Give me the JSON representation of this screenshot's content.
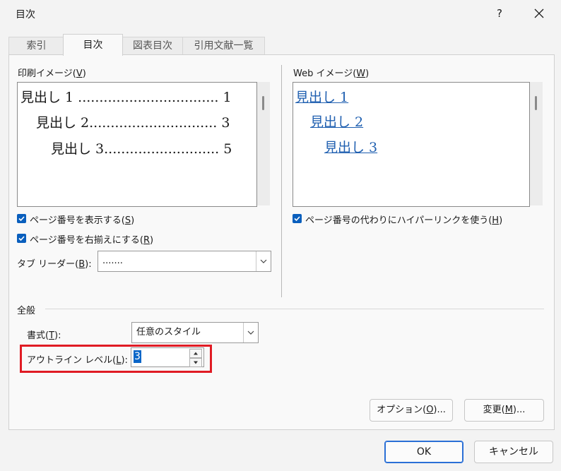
{
  "window": {
    "title": "目次",
    "help_label": "?",
    "close_icon": "close-icon"
  },
  "tabs": [
    {
      "label": "索引",
      "active": false
    },
    {
      "label": "目次",
      "active": true
    },
    {
      "label": "図表目次",
      "active": false
    },
    {
      "label": "引用文献一覧",
      "active": false
    }
  ],
  "print_preview": {
    "label_prefix": "印刷イメージ(",
    "label_key": "V",
    "label_suffix": ")",
    "entries": [
      {
        "text": "見出し 1 ................................. 1"
      },
      {
        "text": "見出し 2.............................. 3"
      },
      {
        "text": "見出し 3........................... 5"
      }
    ]
  },
  "web_preview": {
    "label_prefix": "Web イメージ(",
    "label_key": "W",
    "label_suffix": ")",
    "entries": [
      {
        "text": "見出し 1"
      },
      {
        "text": "見出し 2"
      },
      {
        "text": "見出し 3"
      }
    ]
  },
  "options": {
    "show_page_numbers": {
      "prefix": "ページ番号を表示する(",
      "key": "S",
      "suffix": ")",
      "checked": true
    },
    "right_align": {
      "prefix": "ページ番号を右揃えにする(",
      "key": "R",
      "suffix": ")",
      "checked": true
    },
    "tab_leader": {
      "prefix": "タブ リーダー(",
      "key": "B",
      "suffix": "):",
      "value": "......."
    },
    "use_hyperlinks": {
      "prefix": "ページ番号の代わりにハイパーリンクを使う(",
      "key": "H",
      "suffix": ")",
      "checked": true
    }
  },
  "general": {
    "heading": "全般",
    "format": {
      "prefix": "書式(",
      "key": "T",
      "suffix": "):",
      "value": "任意のスタイル"
    },
    "outline_level": {
      "prefix": "アウトライン レベル(",
      "key": "L",
      "suffix": "):",
      "value": "3"
    }
  },
  "buttons": {
    "options": {
      "prefix": "オプション(",
      "key": "O",
      "suffix": ")..."
    },
    "modify": {
      "prefix": "変更(",
      "key": "M",
      "suffix": ")..."
    },
    "ok": "OK",
    "cancel": "キャンセル"
  },
  "colors": {
    "accent": "#0a5fbd",
    "link": "#1f5fb0",
    "highlight_border": "#e01b24"
  }
}
